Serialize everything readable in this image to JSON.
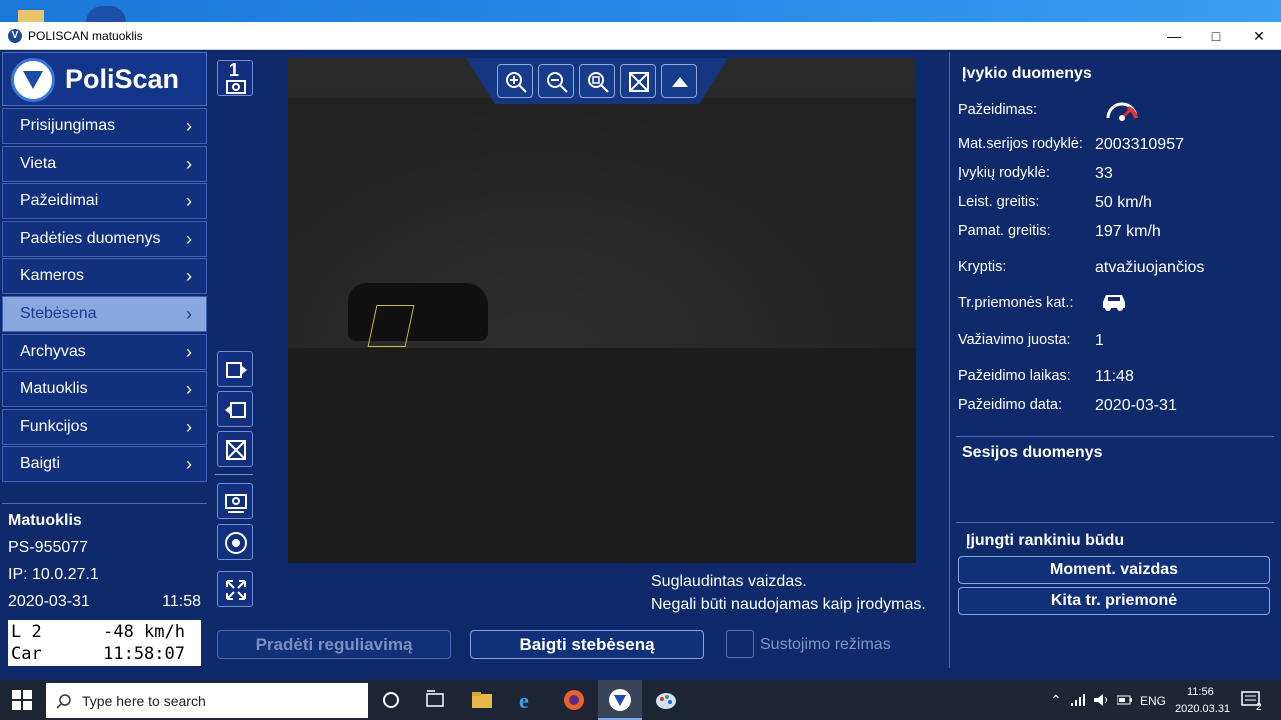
{
  "window": {
    "title": "POLISCAN matuoklis",
    "icon": "poliscan-icon",
    "controls": [
      "minimize-icon",
      "maximize-icon",
      "close-icon"
    ]
  },
  "logo": {
    "text": "PoliScan"
  },
  "sidebar": {
    "items": [
      {
        "label": "Prisijungimas",
        "active": false
      },
      {
        "label": "Vieta",
        "active": false
      },
      {
        "label": "Pažeidimai",
        "active": false
      },
      {
        "label": "Padėties duomenys",
        "active": false
      },
      {
        "label": "Kameros",
        "active": false
      },
      {
        "label": "Stebėsena",
        "active": true
      },
      {
        "label": "Archyvas",
        "active": false
      },
      {
        "label": "Matuoklis",
        "active": false
      },
      {
        "label": "Funkcijos",
        "active": false
      },
      {
        "label": "Baigti",
        "active": false
      }
    ],
    "meter": {
      "title": "Matuoklis",
      "serial": "PS-955077",
      "ip": "IP: 10.0.27.1",
      "date": "2020-03-31",
      "time": "11:58",
      "lcd_line1": "L 2      -48 km/h",
      "lcd_line2": "Car      11:58:07"
    }
  },
  "toolbar": {
    "camera_number": "1",
    "icons": [
      "camera-1-icon",
      "next-frame-icon",
      "prev-frame-icon",
      "clear-roi-icon",
      "camera-settings-icon",
      "shutter-icon",
      "fullscreen-icon"
    ]
  },
  "zoom_bar": {
    "icons": [
      "zoom-in-icon",
      "zoom-out-icon",
      "zoom-fit-icon",
      "clear-image-icon",
      "collapse-up-icon"
    ]
  },
  "image_caption": {
    "line1": "Suglaudintas vaizdas.",
    "line2": "Negali būti naudojamas kaip įrodymas."
  },
  "bottom_controls": {
    "start_button": "Pradėti reguliavimą",
    "stop_button": "Baigti stebėseną",
    "stop_mode_label": "Sustojimo režimas"
  },
  "event_data": {
    "title": "Įvykio duomenys",
    "rows": [
      {
        "label": "Pažeidimas:",
        "value": ""
      },
      {
        "label": "Mat.serijos rodyklė:",
        "value": "2003310957"
      },
      {
        "label": "Įvykių rodyklė:",
        "value": "33"
      },
      {
        "label": "Leist. greitis:",
        "value": "50 km/h"
      },
      {
        "label": "Pamat. greitis:",
        "value": "197 km/h"
      },
      {
        "label": "Kryptis:",
        "value": "atvažiuojančios"
      },
      {
        "label": "Tr.priemonės kat.:",
        "value": ""
      },
      {
        "label": "Važiavimo juosta:",
        "value": "1"
      },
      {
        "label": "Pažeidimo laikas:",
        "value": "11:48"
      },
      {
        "label": "Pažeidimo data:",
        "value": "2020-03-31"
      }
    ],
    "violation_icon": "speedometer-icon",
    "vehicle_icon": "car-icon"
  },
  "session": {
    "title": "Sesijos duomenys"
  },
  "manual": {
    "title": "Įjungti rankiniu būdu",
    "snapshot_button": "Moment. vaizdas",
    "other_vehicle_button": "Kita tr. priemonė"
  },
  "taskbar": {
    "search_placeholder": "Type here to search",
    "language": "ENG",
    "time": "11:56",
    "date": "2020.03.31",
    "notifications": "2"
  },
  "colors": {
    "app_bg": "#0f2a6b",
    "active_nav": "#8aa8e0",
    "roi_outline": "#d6b84a",
    "speed_icon_red": "#e03030"
  }
}
